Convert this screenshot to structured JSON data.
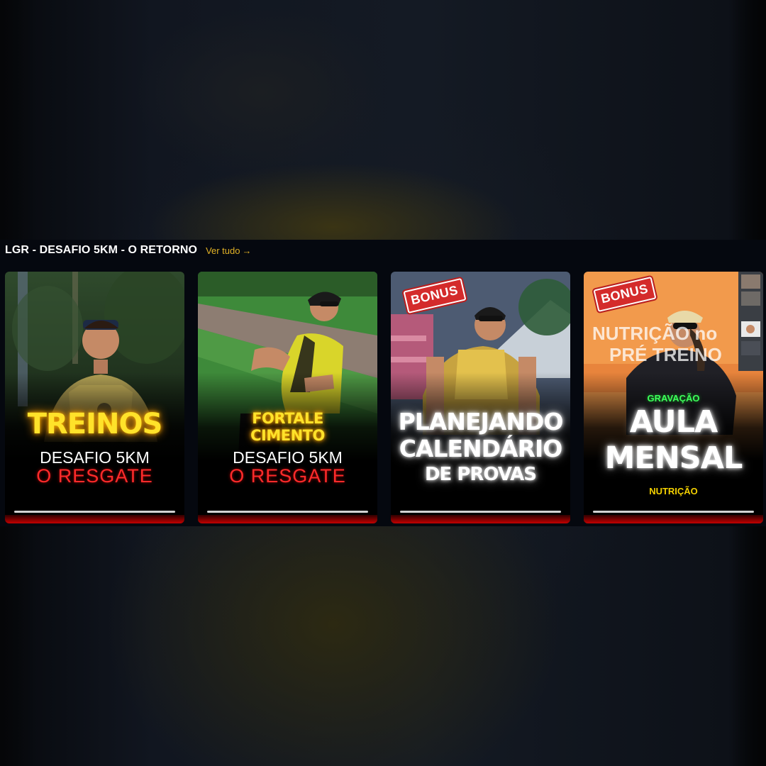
{
  "row": {
    "title": "LGR - DESAFIO 5KM - O RETORNO",
    "see_all_label": "Ver tudo",
    "see_all_arrow": "→"
  },
  "cards": [
    {
      "title_line1": "TREINOS",
      "subtitle": "DESAFIO 5KM",
      "tagline": "O RESGATE"
    },
    {
      "title_line1": "FORTALE",
      "title_line2": "CIMENTO",
      "subtitle": "DESAFIO 5KM",
      "tagline": "O RESGATE"
    },
    {
      "badge": "BONUS",
      "title_line1": "PLANEJANDO",
      "title_line2": "CALENDÁRIO",
      "title_line3": "DE PROVAS"
    },
    {
      "badge": "BONUS",
      "kicker": "GRAVAÇÃO",
      "title_line1": "AULA",
      "title_line2": "MENSAL",
      "footer": "NUTRIÇÃO",
      "slide_text_line1": "NUTRIÇÃO no",
      "slide_text_line2": "PRÉ TREINO"
    }
  ],
  "colors": {
    "accent_link": "#e2b226",
    "neon_yellow": "#ffe22a",
    "neon_red": "#ff2b2b",
    "bonus_red": "#d42b2b",
    "neon_green": "#3dff5a"
  }
}
